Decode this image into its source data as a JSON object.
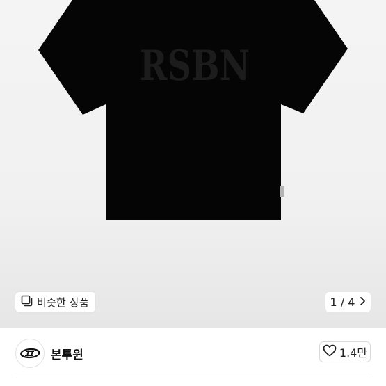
{
  "product": {
    "print_text": "RSBN"
  },
  "gallery": {
    "similar_label": "비슷한 상품",
    "page_indicator": "1 / 4"
  },
  "store": {
    "name": "본투윈",
    "likes": "1.4만"
  },
  "colors": {
    "shirt": "#050505",
    "print": "#1c1c1c",
    "background": "#f2f2f2"
  },
  "icons": {
    "similar": "gallery-copy-icon",
    "next": "chevron-right-icon",
    "like": "heart-outline-icon",
    "logo": "btw-logo-icon"
  }
}
